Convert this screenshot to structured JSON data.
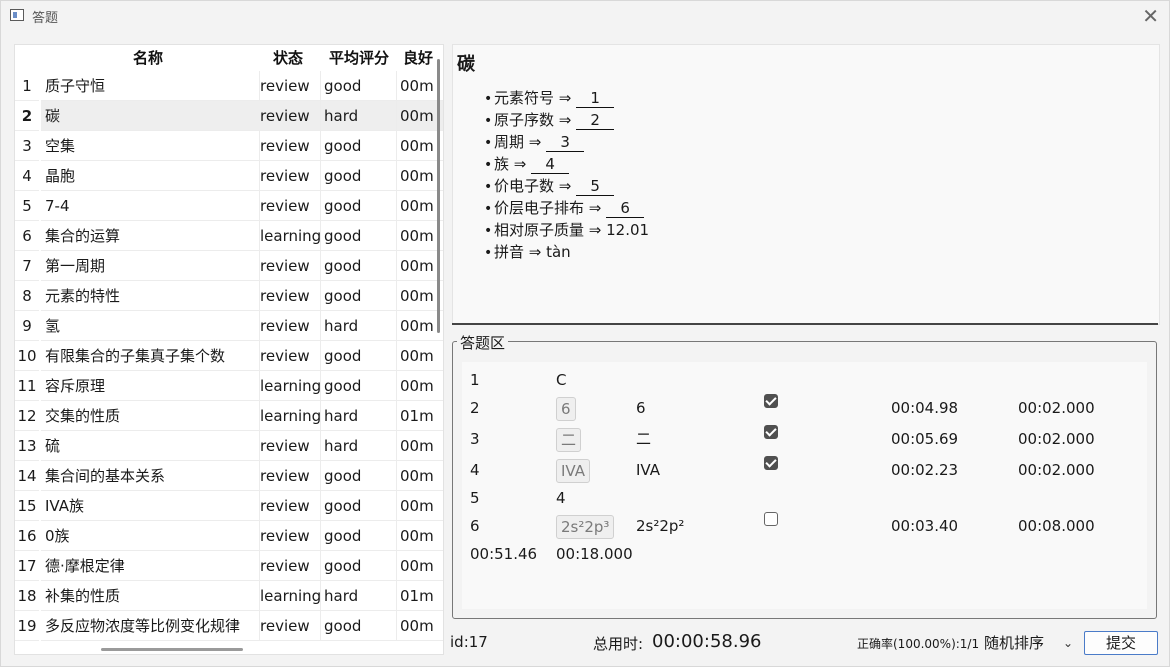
{
  "window": {
    "title": "答题"
  },
  "table": {
    "headers": [
      "名称",
      "状态",
      "平均评分",
      "良好"
    ],
    "rows": [
      {
        "idx": "1",
        "name": "质子守恒",
        "status": "review",
        "score": "good",
        "good": "00m"
      },
      {
        "idx": "2",
        "name": "碳",
        "status": "review",
        "score": "hard",
        "good": "00m",
        "selected": true
      },
      {
        "idx": "3",
        "name": "空集",
        "status": "review",
        "score": "good",
        "good": "00m"
      },
      {
        "idx": "4",
        "name": "晶胞",
        "status": "review",
        "score": "good",
        "good": "00m"
      },
      {
        "idx": "5",
        "name": "7-4",
        "status": "review",
        "score": "good",
        "good": "00m"
      },
      {
        "idx": "6",
        "name": "集合的运算",
        "status": "learning",
        "score": "good",
        "good": "00m"
      },
      {
        "idx": "7",
        "name": "第一周期",
        "status": "review",
        "score": "good",
        "good": "00m"
      },
      {
        "idx": "8",
        "name": "元素的特性",
        "status": "review",
        "score": "good",
        "good": "00m"
      },
      {
        "idx": "9",
        "name": "氢",
        "status": "review",
        "score": "hard",
        "good": "00m"
      },
      {
        "idx": "10",
        "name": "有限集合的子集真子集个数",
        "status": "review",
        "score": "good",
        "good": "00m"
      },
      {
        "idx": "11",
        "name": "容斥原理",
        "status": "learning",
        "score": "good",
        "good": "00m"
      },
      {
        "idx": "12",
        "name": "交集的性质",
        "status": "learning",
        "score": "hard",
        "good": "01m"
      },
      {
        "idx": "13",
        "name": "硫",
        "status": "review",
        "score": "hard",
        "good": "00m"
      },
      {
        "idx": "14",
        "name": "集合间的基本关系",
        "status": "review",
        "score": "good",
        "good": "00m"
      },
      {
        "idx": "15",
        "name": "IVA族",
        "status": "review",
        "score": "good",
        "good": "00m"
      },
      {
        "idx": "16",
        "name": "0族",
        "status": "review",
        "score": "good",
        "good": "00m"
      },
      {
        "idx": "17",
        "name": "德·摩根定律",
        "status": "review",
        "score": "good",
        "good": "00m"
      },
      {
        "idx": "18",
        "name": "补集的性质",
        "status": "learning",
        "score": "hard",
        "good": "01m"
      },
      {
        "idx": "19",
        "name": "多反应物浓度等比例变化规律",
        "status": "review",
        "score": "good",
        "good": "00m"
      }
    ]
  },
  "card": {
    "title": "碳",
    "fields": [
      {
        "label": "元素符号 ⇒ ",
        "blank": "1"
      },
      {
        "label": "原子序数 ⇒ ",
        "blank": "2"
      },
      {
        "label": "周期 ⇒ ",
        "blank": "3"
      },
      {
        "label": "族 ⇒ ",
        "blank": "4"
      },
      {
        "label": "价电子数 ⇒ ",
        "blank": "5"
      },
      {
        "label": "价层电子排布 ⇒ ",
        "blank": "6"
      },
      {
        "label": "相对原子质量 ⇒ 12.01"
      },
      {
        "label": "拼音 ⇒ tàn"
      }
    ]
  },
  "answer_area": {
    "legend": "答题区",
    "rows": [
      {
        "num": "1",
        "given": "C"
      },
      {
        "num": "2",
        "chip": "6",
        "answer": "6",
        "checked": true,
        "time": "00:04.98",
        "limit": "00:02.000"
      },
      {
        "num": "3",
        "chip": "二",
        "answer": "二",
        "checked": true,
        "time": "00:05.69",
        "limit": "00:02.000"
      },
      {
        "num": "4",
        "chip": "IVA",
        "answer": "IVA",
        "checked": true,
        "time": "00:02.23",
        "limit": "00:02.000"
      },
      {
        "num": "5",
        "given": "4"
      },
      {
        "num": "6",
        "chip": "2s²2p³",
        "answer": "2s²2p²",
        "checked": false,
        "time": "00:03.40",
        "limit": "00:08.000"
      }
    ],
    "summary": {
      "time": "00:51.46",
      "limit": "00:18.000"
    }
  },
  "bottom": {
    "id": "id:17",
    "total_label": "总用时:",
    "total_time": "00:00:58.96",
    "accuracy": "正确率(100.00%):1/1",
    "sort_select": "随机排序",
    "submit": "提交"
  },
  "icons": {
    "app": "window-app-icon",
    "close": "close-icon",
    "chevron": "chevron-down-icon",
    "bullet": "bullet-icon"
  }
}
